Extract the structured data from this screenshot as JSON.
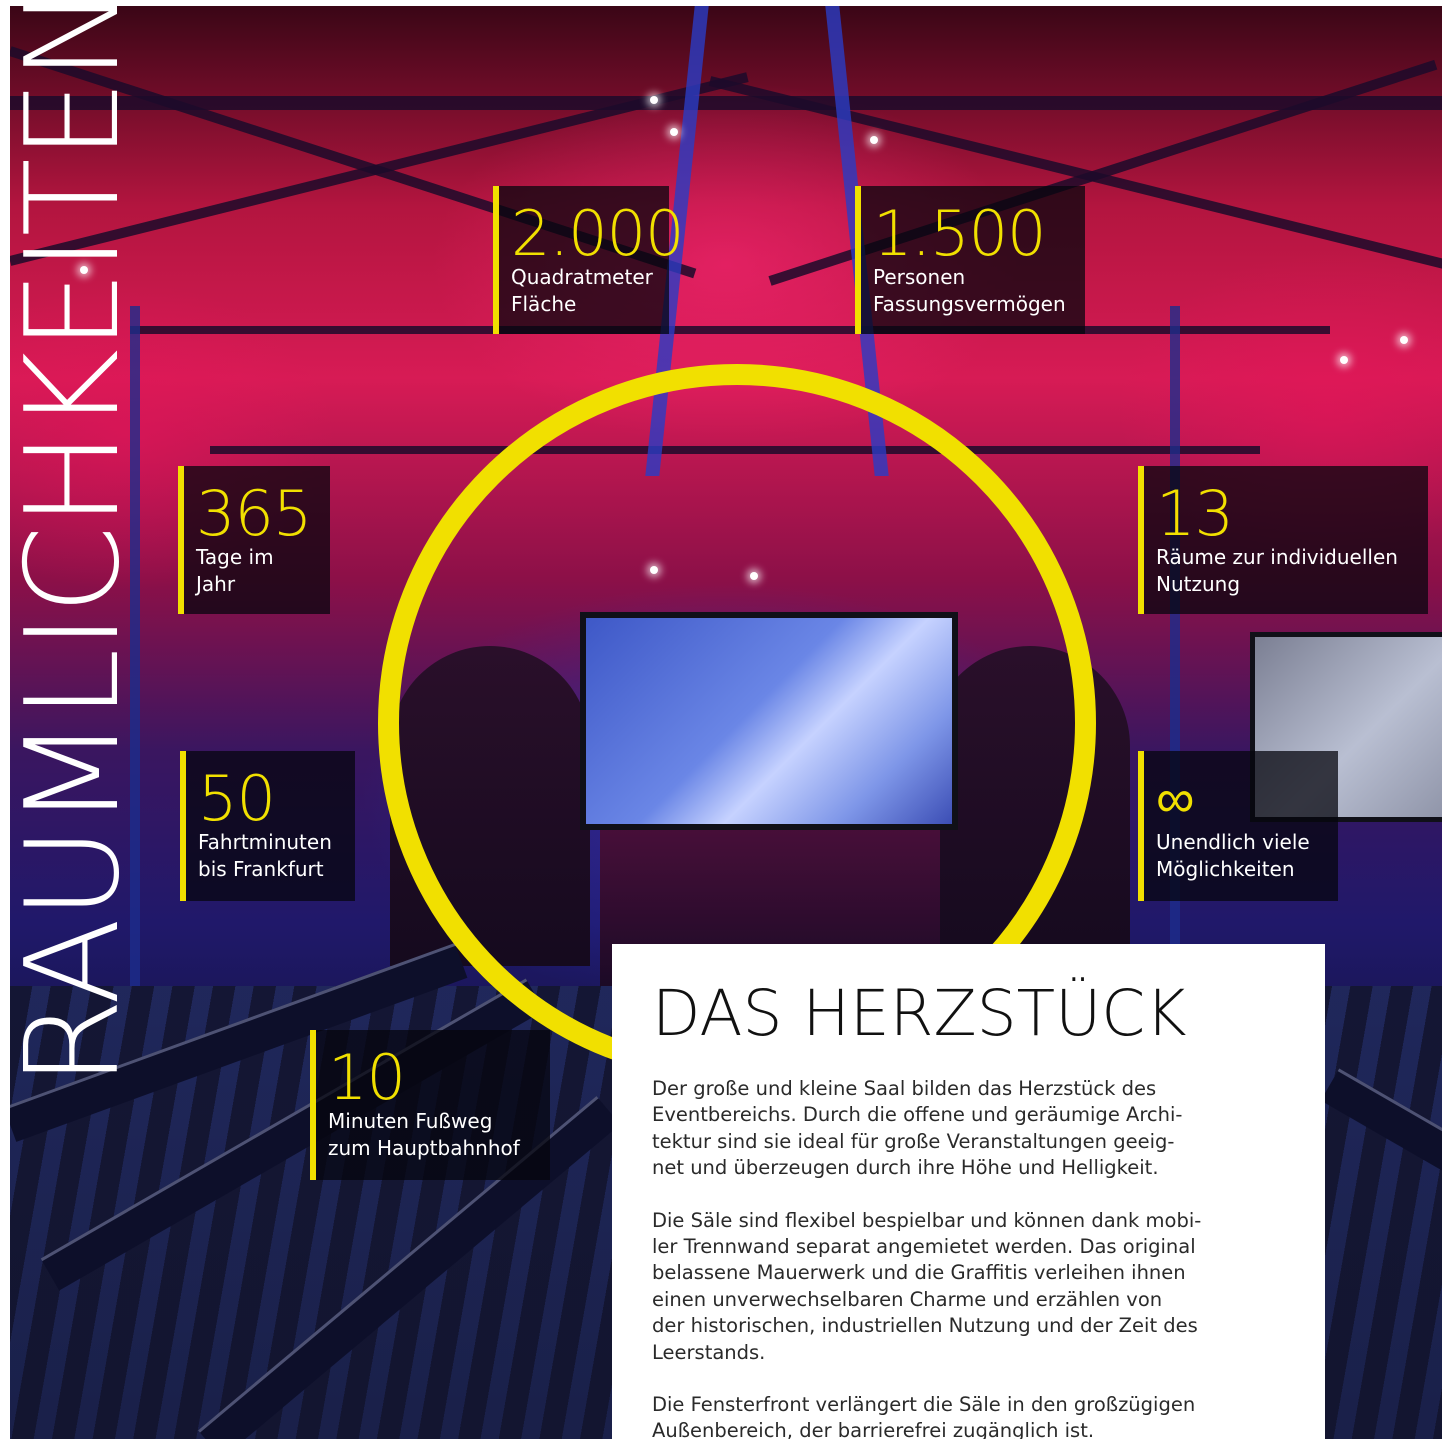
{
  "vertical_title": "RÄUMLICHKEITEN",
  "stats": [
    {
      "value": "2.000",
      "label_lines": [
        "Quadratmeter",
        "Fläche"
      ]
    },
    {
      "value": "1.500",
      "label_lines": [
        "Personen",
        "Fassungsvermögen"
      ]
    },
    {
      "value": "365",
      "label_lines": [
        "Tage im",
        "Jahr"
      ]
    },
    {
      "value": "13",
      "label_lines": [
        "Räume zur individuellen",
        "Nutzung"
      ]
    },
    {
      "value": "50",
      "label_lines": [
        "Fahrtminuten",
        "bis Frankfurt"
      ]
    },
    {
      "value": "∞",
      "label_lines": [
        "Unendlich viele",
        "Möglichkeiten"
      ]
    },
    {
      "value": "10",
      "label_lines": [
        "Minuten Fußweg",
        "zum Hauptbahnhof"
      ]
    }
  ],
  "panel": {
    "heading": "DAS HERZSTÜCK",
    "paragraphs": [
      [
        "Der große und kleine Saal bilden das Herzstück des",
        "Eventbereichs. Durch die offene und geräumige Archi-",
        "tektur sind sie ideal für große Veranstaltungen geeig-",
        "net und überzeugen durch ihre Höhe und Helligkeit."
      ],
      [
        "Die Säle sind flexibel bespielbar und können dank mobi-",
        "ler Trennwand separat angemietet werden. Das original",
        "belassene Mauerwerk und die Graffitis verleihen ihnen",
        "einen unverwechselbaren Charme und erzählen von",
        "der historischen, industriellen Nutzung und der Zeit des",
        "Leerstands."
      ],
      [
        "Die Fensterfront verlängert die Säle in den großzügigen",
        "Außenbereich, der barrierefrei zugänglich ist."
      ]
    ]
  },
  "colors": {
    "accent": "#f1e000",
    "stat_box_bg": "rgba(6,6,14,0.74)",
    "panel_bg": "#ffffff",
    "text": "#2a2a2a"
  }
}
